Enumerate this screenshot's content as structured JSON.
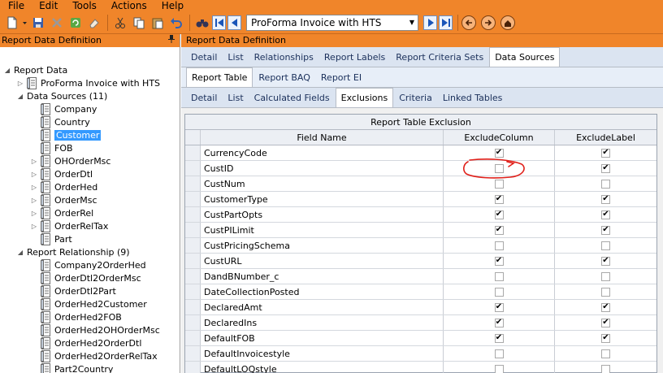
{
  "menu": {
    "items": [
      "File",
      "Edit",
      "Tools",
      "Actions",
      "Help"
    ]
  },
  "toolbar": {
    "icons": [
      "new-icon",
      "save-icon",
      "delete-icon",
      "refresh-icon",
      "clear-icon",
      "cut-icon",
      "copy-icon",
      "paste-icon",
      "undo-icon",
      "binoculars-icon",
      "first-icon",
      "previous-icon",
      "next-icon",
      "last-icon",
      "back-icon",
      "forward-icon",
      "home-icon"
    ],
    "document_selector": "ProForma Invoice with HTS"
  },
  "left_panel": {
    "title": "Report Data Definition",
    "pin_icon": "pin-icon",
    "tree": {
      "root": "Report Data",
      "proforma": "ProForma Invoice with HTS",
      "data_sources_label": "Data Sources (11)",
      "data_sources": [
        "Company",
        "Country",
        "Customer",
        "FOB",
        "OHOrderMsc",
        "OrderDtl",
        "OrderHed",
        "OrderMsc",
        "OrderRel",
        "OrderRelTax",
        "Part"
      ],
      "selected": "Customer",
      "relationships_label": "Report Relationship (9)",
      "relationships": [
        "Company2OrderHed",
        "OrderDtl2OrderMsc",
        "OrderDtl2Part",
        "OrderHed2Customer",
        "OrderHed2FOB",
        "OrderHed2OHOrderMsc",
        "OrderHed2OrderDtl",
        "OrderHed2OrderRelTax",
        "Part2Country"
      ]
    }
  },
  "right_panel": {
    "title": "Report Data Definition",
    "tabs_level1": [
      "Detail",
      "List",
      "Relationships",
      "Report Labels",
      "Report Criteria Sets",
      "Data Sources"
    ],
    "tabs_level1_active": "Data Sources",
    "tabs_level2": [
      "Report Table",
      "Report BAQ",
      "Report EI"
    ],
    "tabs_level2_active": "Report Table",
    "tabs_level3": [
      "Detail",
      "List",
      "Calculated Fields",
      "Exclusions",
      "Criteria",
      "Linked Tables"
    ],
    "tabs_level3_active": "Exclusions",
    "grid": {
      "caption": "Report Table Exclusion",
      "columns": [
        "Field Name",
        "ExcludeColumn",
        "ExcludeLabel"
      ],
      "rows": [
        {
          "field": "CurrencyCode",
          "exclude_column": true,
          "exclude_label": true
        },
        {
          "field": "CustID",
          "exclude_column": false,
          "exclude_label": true
        },
        {
          "field": "CustNum",
          "exclude_column": false,
          "exclude_label": false
        },
        {
          "field": "CustomerType",
          "exclude_column": true,
          "exclude_label": true
        },
        {
          "field": "CustPartOpts",
          "exclude_column": true,
          "exclude_label": true
        },
        {
          "field": "CustPILimit",
          "exclude_column": true,
          "exclude_label": true
        },
        {
          "field": "CustPricingSchema",
          "exclude_column": false,
          "exclude_label": false
        },
        {
          "field": "CustURL",
          "exclude_column": true,
          "exclude_label": true
        },
        {
          "field": "DandBNumber_c",
          "exclude_column": false,
          "exclude_label": false
        },
        {
          "field": "DateCollectionPosted",
          "exclude_column": false,
          "exclude_label": false
        },
        {
          "field": "DeclaredAmt",
          "exclude_column": true,
          "exclude_label": true
        },
        {
          "field": "DeclaredIns",
          "exclude_column": true,
          "exclude_label": true
        },
        {
          "field": "DefaultFOB",
          "exclude_column": true,
          "exclude_label": true
        },
        {
          "field": "DefaultInvoicestyle",
          "exclude_column": false,
          "exclude_label": false
        },
        {
          "field": "DefaultLOQstyle",
          "exclude_column": false,
          "exclude_label": false
        }
      ]
    }
  },
  "annotation": {
    "color": "#e0201a"
  }
}
